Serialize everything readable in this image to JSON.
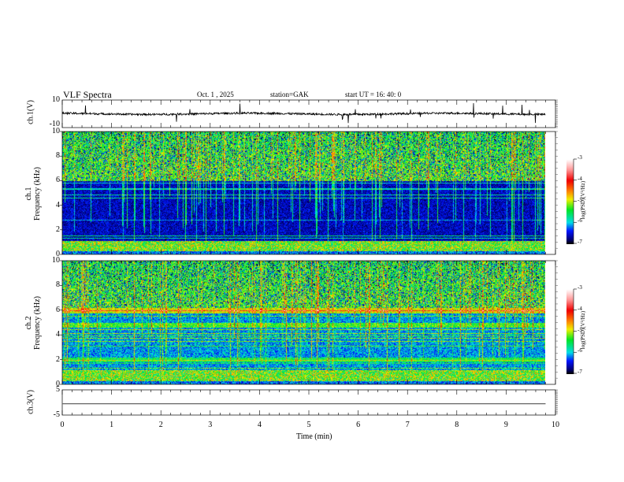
{
  "header": {
    "title": "VLF  Spectra",
    "date": "Oct. 1  , 2025",
    "station": "station=GAK",
    "start": "start  UT  =   16: 40: 0"
  },
  "chart_data": [
    {
      "type": "line",
      "name": "ch1-waveform",
      "ylabel": "ch.1(V)",
      "ylim": [
        -10,
        10
      ],
      "yticks": [
        "10",
        "-10"
      ],
      "xlim": [
        0,
        10
      ]
    },
    {
      "type": "heatmap",
      "name": "ch1-spectrogram",
      "ylabel_line1": "ch.1",
      "ylabel_line2": "Frequency  (kHz)",
      "ylim": [
        0,
        10
      ],
      "yticks": [
        "0",
        "2",
        "4",
        "6",
        "8",
        "10"
      ],
      "xlim": [
        0,
        10
      ],
      "data_end_min": 9.8,
      "colorbar": {
        "label": "log(PSD)(V²/Hz)",
        "range": [
          -7,
          -3
        ],
        "ticks": [
          "-3",
          "-4",
          "-5",
          "-6",
          "-7"
        ]
      }
    },
    {
      "type": "heatmap",
      "name": "ch2-spectrogram",
      "ylabel_line1": "ch.2",
      "ylabel_line2": "Frequency  (kHz)",
      "ylim": [
        0,
        10
      ],
      "yticks": [
        "0",
        "2",
        "4",
        "6",
        "8",
        "10"
      ],
      "xlim": [
        0,
        10
      ],
      "data_end_min": 9.8,
      "colorbar": {
        "label": "log(PSD)(V²/Hz)",
        "range": [
          -7,
          -3
        ],
        "ticks": [
          "-3",
          "-4",
          "-5",
          "-6",
          "-7"
        ]
      }
    },
    {
      "type": "line",
      "name": "ch3-waveform",
      "ylabel": "ch.3(V)",
      "ylim": [
        -5,
        5
      ],
      "yticks": [
        "5",
        "-5"
      ],
      "xlim": [
        0,
        10
      ],
      "level": -0.5
    }
  ],
  "xaxis": {
    "label": "Time  (min)",
    "ticks": [
      "0",
      "1",
      "2",
      "3",
      "4",
      "5",
      "6",
      "7",
      "8",
      "9",
      "10"
    ]
  }
}
